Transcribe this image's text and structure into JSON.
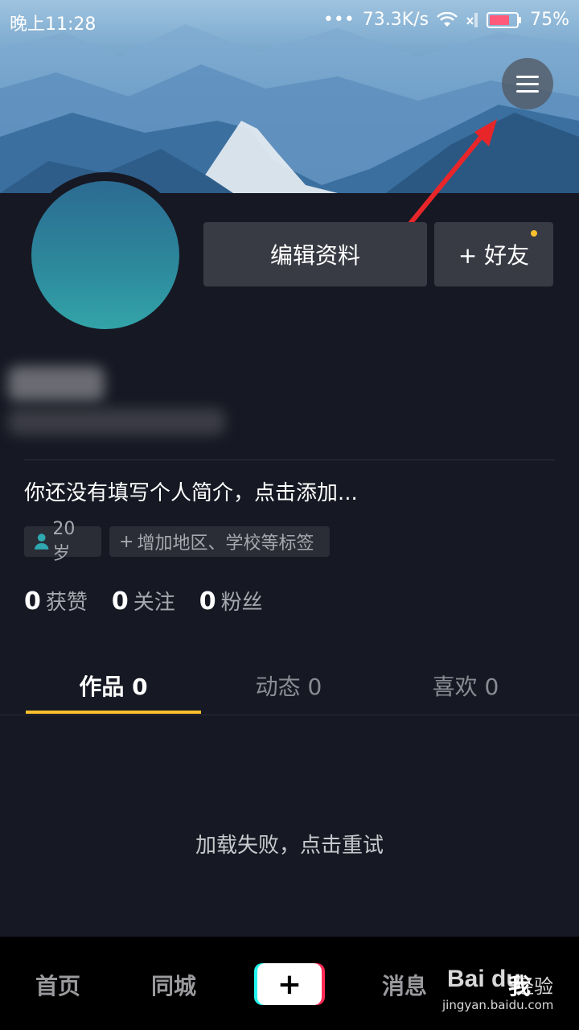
{
  "status_bar": {
    "time": "晚上11:28",
    "network_speed": "73.3K/s",
    "battery": "75%",
    "battery_level": 0.75
  },
  "profile": {
    "edit_button": "编辑资料",
    "add_friend_button": "+ 好友",
    "bio": "你还没有填写个人简介，点击添加...",
    "tags": {
      "age": "20岁",
      "add": "增加地区、学校等标签"
    },
    "stats": [
      {
        "value": "0",
        "label": "获赞"
      },
      {
        "value": "0",
        "label": "关注"
      },
      {
        "value": "0",
        "label": "粉丝"
      }
    ]
  },
  "tabs": [
    {
      "label": "作品 0",
      "active": true
    },
    {
      "label": "动态 0",
      "active": false
    },
    {
      "label": "喜欢 0",
      "active": false
    }
  ],
  "content": {
    "error_message": "加载失败，点击重试"
  },
  "bottom_nav": {
    "home": "首页",
    "nearby": "同城",
    "create": "+",
    "messages": "消息",
    "me": "我"
  },
  "watermark": {
    "logo": "Bai du",
    "cn": "经验",
    "url": "jingyan.baidu.com"
  },
  "colors": {
    "background": "#161823",
    "accent": "#fbc02d",
    "button": "#393b44"
  }
}
